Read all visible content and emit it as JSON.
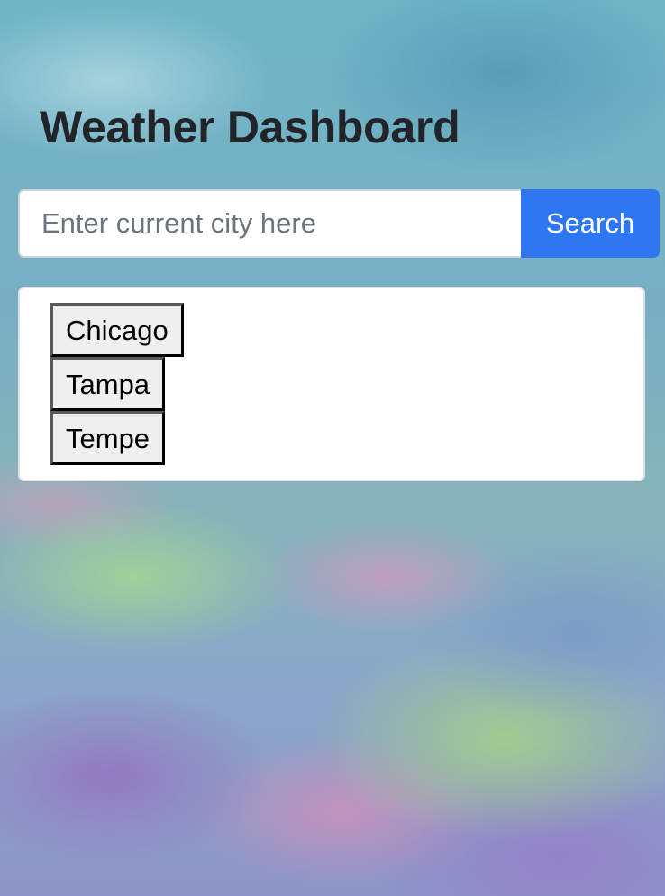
{
  "header": {
    "title": "Weather Dashboard"
  },
  "search": {
    "placeholder": "Enter current city here",
    "value": "",
    "button_label": "Search"
  },
  "history": {
    "cities": [
      "Chicago",
      "Tampa",
      "Tempe"
    ]
  },
  "colors": {
    "accent": "#2f77f2",
    "title_text": "#212529"
  }
}
